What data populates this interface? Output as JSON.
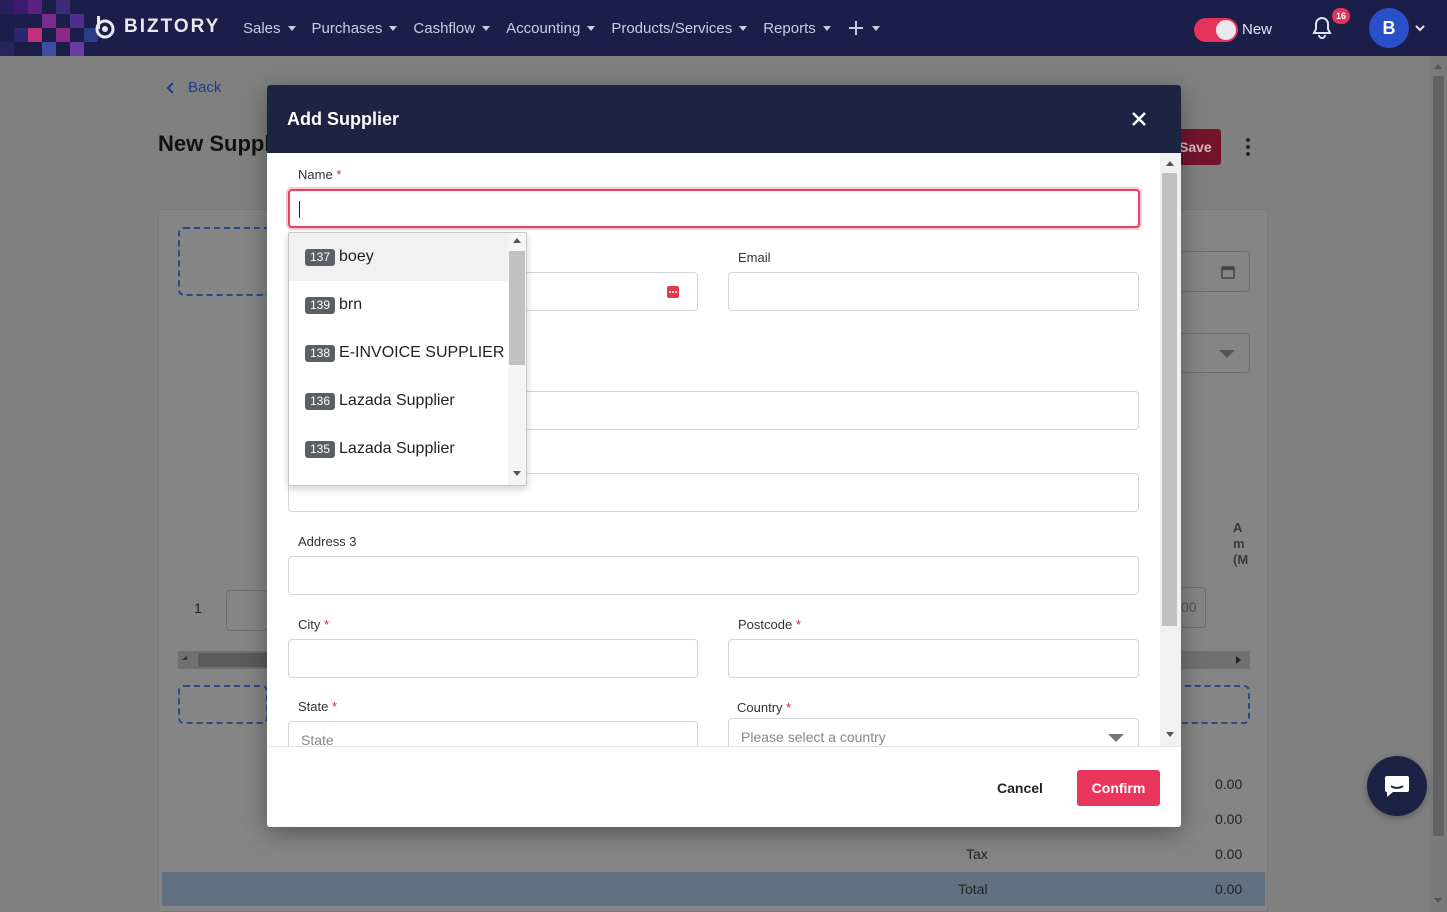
{
  "brand": {
    "name": "BIZTORY"
  },
  "nav": {
    "items": [
      {
        "label": "Sales"
      },
      {
        "label": "Purchases"
      },
      {
        "label": "Cashflow"
      },
      {
        "label": "Accounting"
      },
      {
        "label": "Products/Services"
      },
      {
        "label": "Reports"
      }
    ],
    "add_icon": "plus-icon",
    "toggle_label": "New",
    "toggle_on": true,
    "notifications_count": "16",
    "avatar_initial": "B"
  },
  "page": {
    "back_label": "Back",
    "title": "New Supplier",
    "save_label": "Save",
    "row_number": "1",
    "amount_header": "Am (M",
    "line_value": "00",
    "totals": [
      {
        "label": "",
        "value": "0.00"
      },
      {
        "label": "",
        "value": "0.00"
      },
      {
        "label": "Tax",
        "value": "0.00"
      },
      {
        "label": "Total",
        "value": "0.00"
      }
    ]
  },
  "modal": {
    "title": "Add Supplier",
    "fields": {
      "name": {
        "label": "Name",
        "value": ""
      },
      "email": {
        "label": "Email",
        "value": ""
      },
      "address3": {
        "label": "Address 3",
        "value": ""
      },
      "city": {
        "label": "City",
        "value": ""
      },
      "postcode": {
        "label": "Postcode",
        "value": ""
      },
      "state": {
        "label": "State",
        "placeholder": "State"
      },
      "country": {
        "label": "Country",
        "placeholder": "Please select a country"
      }
    },
    "cancel_label": "Cancel",
    "confirm_label": "Confirm"
  },
  "suggestions": [
    {
      "id": "137",
      "name": "boey"
    },
    {
      "id": "139",
      "name": "brn"
    },
    {
      "id": "138",
      "name": "E-INVOICE SUPPLIER"
    },
    {
      "id": "136",
      "name": "Lazada Supplier"
    },
    {
      "id": "135",
      "name": "Lazada Supplier"
    }
  ],
  "colors": {
    "nav_bg": "#1c1e4a",
    "modal_header": "#1c2442",
    "accent": "#e8365d",
    "avatar": "#2950c8"
  }
}
